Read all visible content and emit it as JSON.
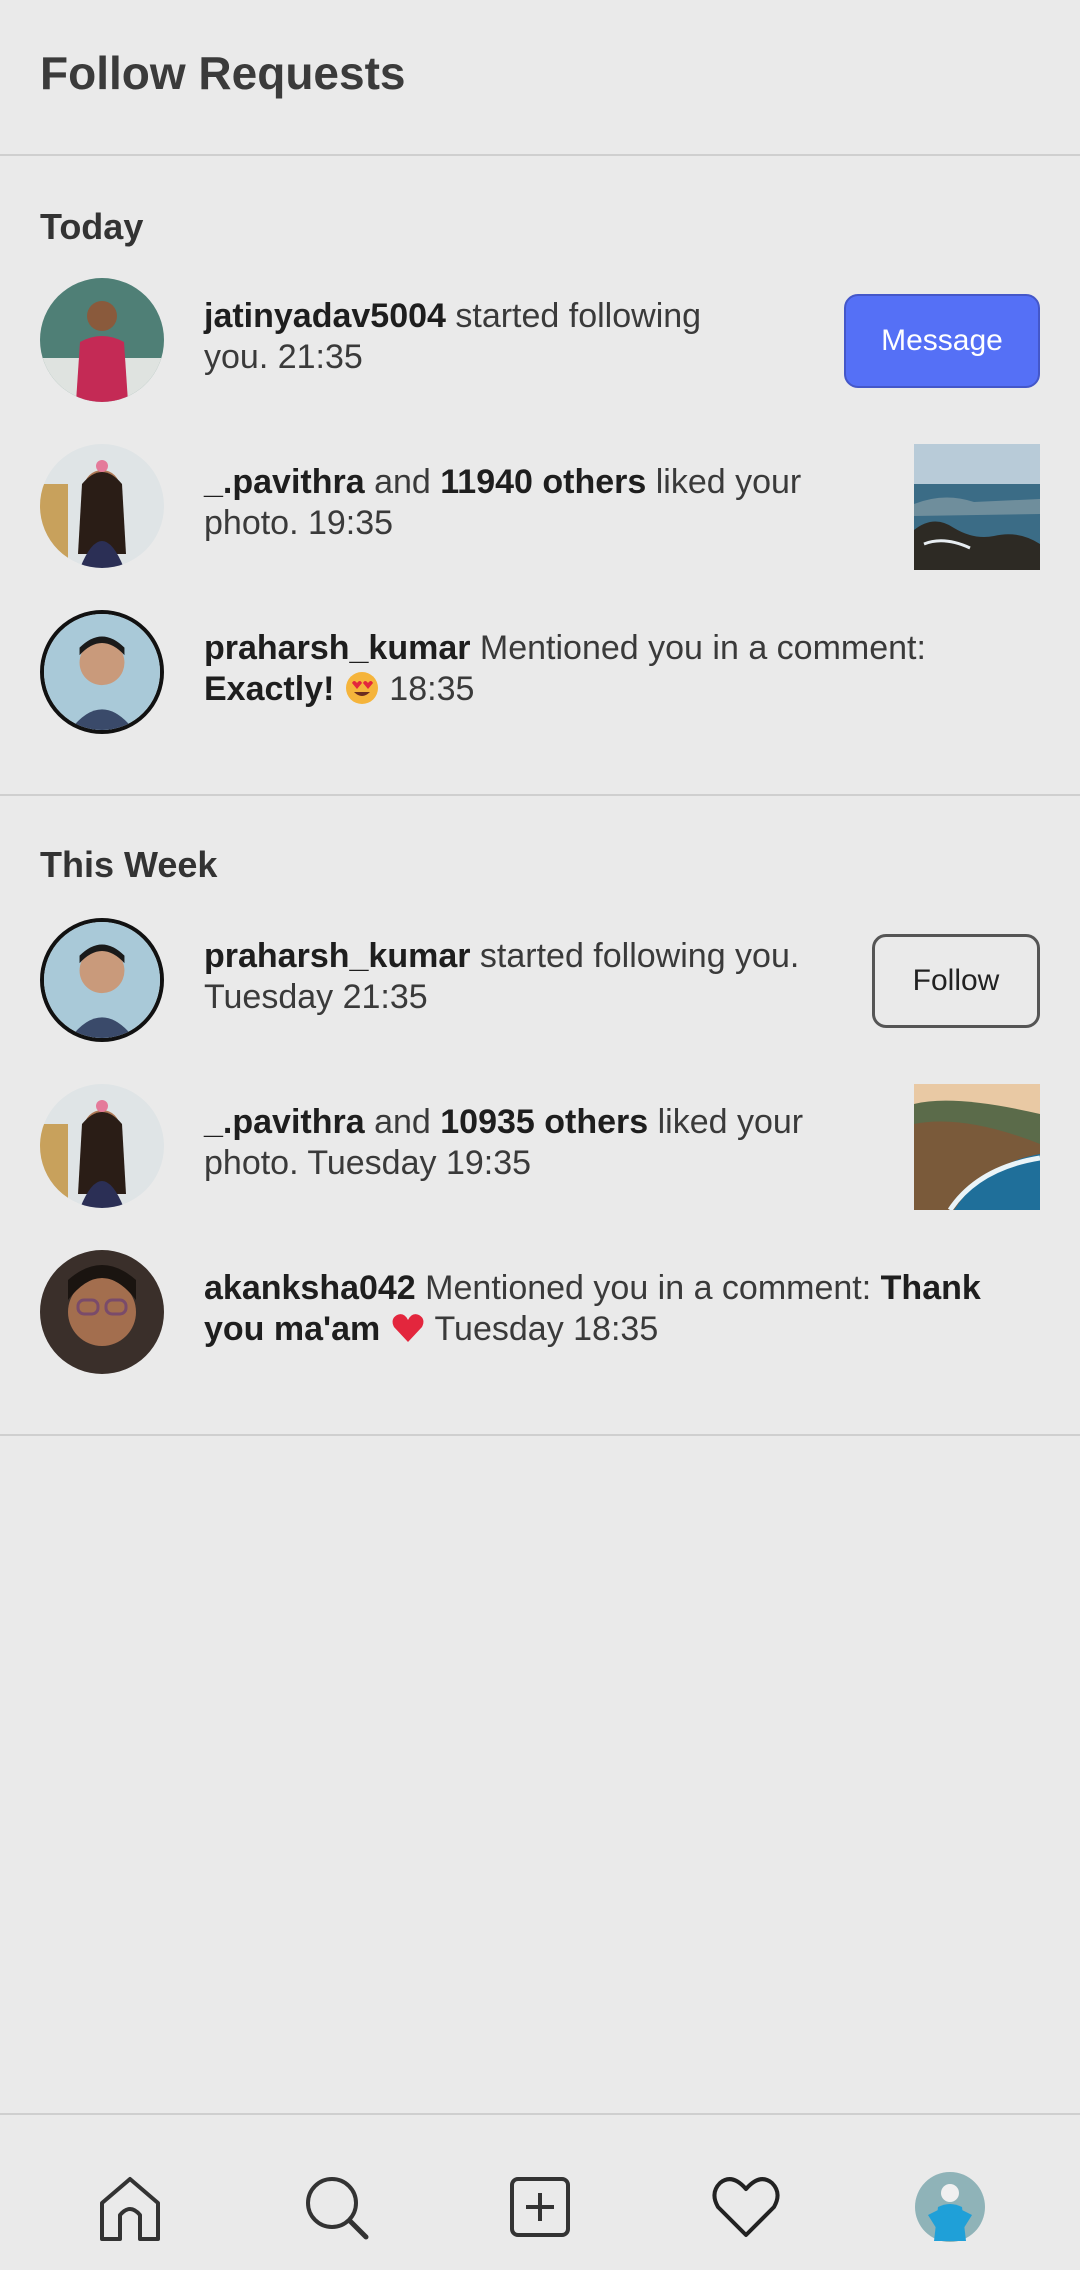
{
  "header": {
    "title": "Follow Requests"
  },
  "sections": [
    {
      "title": "Today",
      "items": [
        {
          "user": "jatinyadav5004",
          "action": " started following",
          "line2": "you. 21:35",
          "button": "Message"
        },
        {
          "user": "_.pavithra",
          "and": " and ",
          "others": "11940 others",
          "action": " liked your",
          "line2": "photo. 19:35"
        },
        {
          "user": "praharsh_kumar",
          "action": " Mentioned you in a comment:",
          "comment": "Exactly!",
          "time": " 18:35"
        }
      ]
    },
    {
      "title": "This Week",
      "items": [
        {
          "user": "praharsh_kumar",
          "action": " started following you.",
          "line2": "Tuesday 21:35",
          "button": "Follow"
        },
        {
          "user": "_.pavithra",
          "and": " and ",
          "others": "10935 others",
          "action": " liked your",
          "line2": "photo. Tuesday 19:35"
        },
        {
          "user": "akanksha042",
          "action": " Mentioned you in a comment: ",
          "comment1": "Thank",
          "comment2": "you ma'am",
          "time": " Tuesday 18:35"
        }
      ]
    }
  ],
  "icons": {
    "heart_eyes_emoji": "heart-eyes-emoji",
    "red_heart_emoji": "red-heart-emoji"
  },
  "nav": [
    "home-icon",
    "search-icon",
    "add-post-icon",
    "activity-heart-icon",
    "profile-avatar"
  ],
  "colors": {
    "accent": "#5570f6",
    "background": "#eaeaea",
    "divider": "#cfcfcf"
  }
}
